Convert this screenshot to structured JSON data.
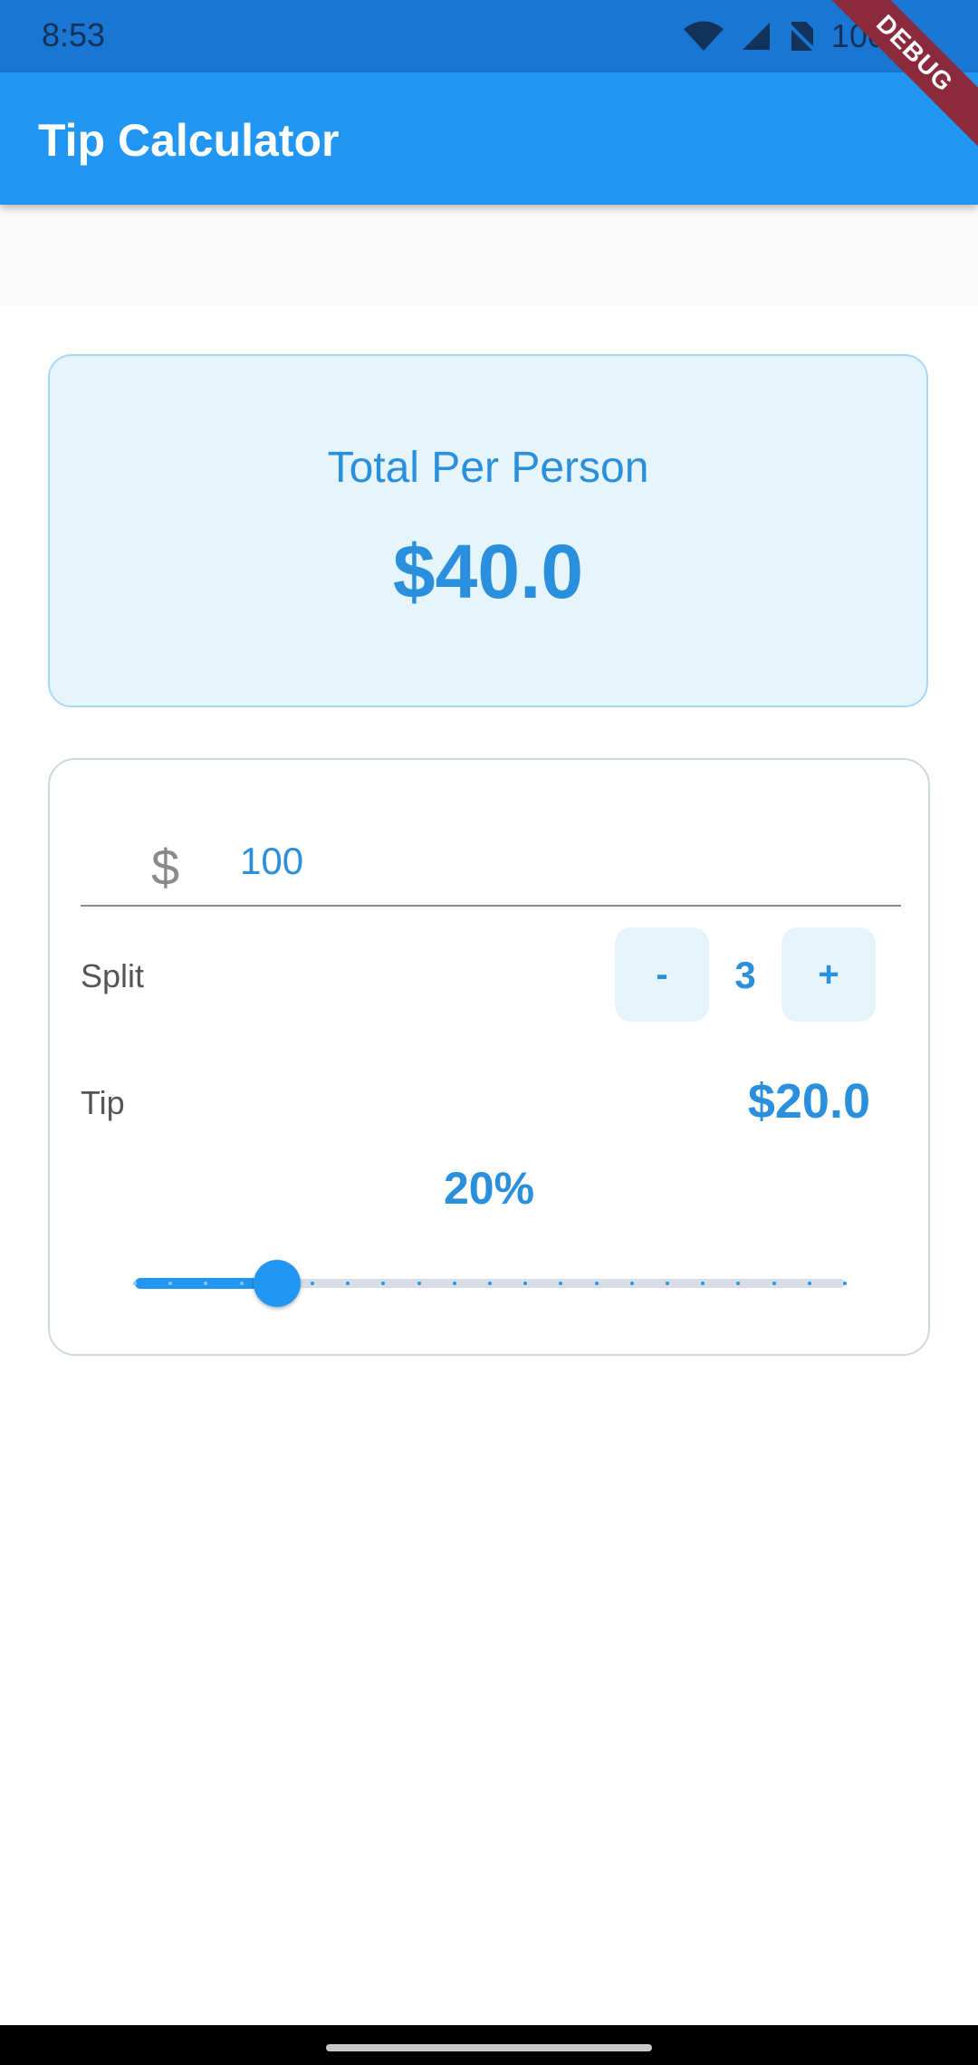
{
  "status_bar": {
    "time": "8:53",
    "battery_text": "100%",
    "icons": [
      "wifi-icon",
      "cell-signal-icon",
      "no-sim-icon"
    ]
  },
  "app_bar": {
    "title": "Tip Calculator",
    "debug_label": "DEBUG"
  },
  "total": {
    "label": "Total Per Person",
    "amount": "$40.0"
  },
  "bill": {
    "prefix": "$",
    "value": "100"
  },
  "split": {
    "label": "Split",
    "decrement_label": "-",
    "count": "3",
    "increment_label": "+"
  },
  "tip": {
    "label": "Tip",
    "amount": "$20.0",
    "percent_label": "20%",
    "slider": {
      "value": 20,
      "min": 0,
      "max": 100,
      "divisions": 20
    }
  },
  "colors": {
    "primary": "#2196f3",
    "accent_text": "#2a8fdc",
    "card_fill": "#e6f4fc",
    "status_bar": "#1976d2",
    "debug_banner": "#8b2a3c"
  }
}
